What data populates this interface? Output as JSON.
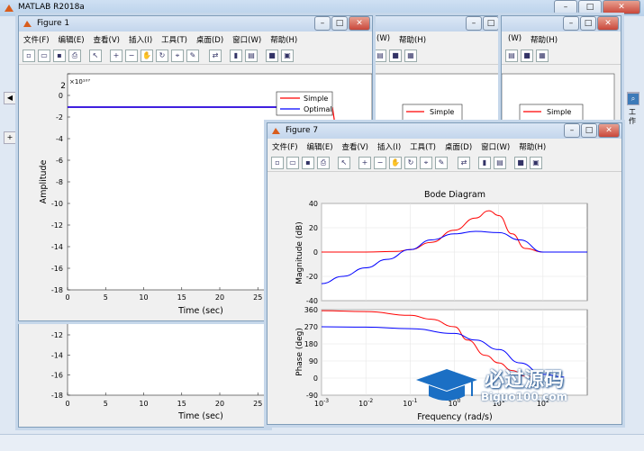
{
  "main_window": {
    "title": "MATLAB R2018a",
    "side_label": "工作"
  },
  "menus": [
    "文件(F)",
    "编辑(E)",
    "查看(V)",
    "插入(I)",
    "工具(T)",
    "桌面(D)",
    "窗口(W)",
    "帮助(H)"
  ],
  "menus_partial": [
    "(W)",
    "帮助(H)"
  ],
  "figure1": {
    "title": "Figure 1",
    "exponent": "×10¹⁰⁷",
    "exp_base": "2",
    "xlabel": "Time (sec)",
    "ylabel": "Amplitude",
    "legend": [
      "Simple",
      "Optimal"
    ]
  },
  "figure_lower": {
    "xlabel": "Time (sec)"
  },
  "figure_back": {
    "legend": [
      "Simple",
      "Optimal"
    ]
  },
  "figure7": {
    "title": "Figure 7",
    "plot_title": "Bode Diagram",
    "mag_ylabel": "Magnitude (dB)",
    "phase_ylabel": "Phase (deg)",
    "xlabel": "Frequency  (rad/s)"
  },
  "watermark": {
    "name": "必过源码",
    "url": "Biguo100.com"
  },
  "chart_data": [
    {
      "type": "line",
      "title": "",
      "xlabel": "Time (sec)",
      "ylabel": "Amplitude",
      "x_ticks": [
        "0",
        "5",
        "10",
        "15",
        "20",
        "25",
        "30",
        "35"
      ],
      "y_ticks": [
        "2",
        "0",
        "-2",
        "-4",
        "-6",
        "-8",
        "-10",
        "-12",
        "-14",
        "-16",
        "-18"
      ],
      "exponent": "10^107",
      "xlim": [
        0,
        40
      ],
      "ylim": [
        -18,
        2
      ],
      "series": [
        {
          "name": "Simple",
          "color": "#ff0000",
          "x": [
            0,
            38
          ],
          "y": [
            0,
            0
          ]
        },
        {
          "name": "Optimal",
          "color": "#0000ff",
          "x": [
            0,
            38
          ],
          "y": [
            0,
            0
          ]
        }
      ],
      "legend_position": "top-right"
    },
    {
      "type": "line",
      "title": "",
      "xlabel": "Time (sec)",
      "x_ticks": [
        "0",
        "5",
        "10",
        "15",
        "20",
        "25",
        "30",
        "35"
      ],
      "y_ticks": [
        "-12",
        "-14",
        "-16",
        "-18"
      ],
      "xlim": [
        0,
        40
      ],
      "ylim": [
        -18,
        -10
      ]
    },
    {
      "type": "line",
      "title": "Bode Diagram",
      "xlabel": "Frequency  (rad/s)",
      "ylabel": "Magnitude (dB)",
      "x_scale": "log",
      "x_ticks": [
        "10^-3",
        "10^-2",
        "10^-1",
        "10^0",
        "10^1",
        "10^2"
      ],
      "y_ticks": [
        "40",
        "20",
        "0",
        "-20",
        "-40"
      ],
      "xlim": [
        0.001,
        1000
      ],
      "ylim": [
        -40,
        40
      ],
      "series": [
        {
          "name": "Simple",
          "color": "#ff0000",
          "x": [
            0.001,
            0.01,
            0.05,
            0.1,
            0.3,
            1,
            3,
            6,
            10,
            20,
            40,
            100,
            300,
            1000
          ],
          "y": [
            0,
            0,
            0.5,
            2,
            8,
            18,
            28,
            34,
            30,
            15,
            3,
            0,
            0,
            0
          ]
        },
        {
          "name": "Optimal",
          "color": "#0000ff",
          "x": [
            0.001,
            0.003,
            0.01,
            0.03,
            0.1,
            0.3,
            1,
            3,
            10,
            30,
            100,
            300,
            1000
          ],
          "y": [
            -26,
            -20,
            -13,
            -6,
            2,
            10,
            15,
            17,
            16,
            10,
            0,
            0,
            0
          ]
        }
      ]
    },
    {
      "type": "line",
      "title": "",
      "xlabel": "Frequency  (rad/s)",
      "ylabel": "Phase (deg)",
      "x_scale": "log",
      "x_ticks": [
        "10^-3",
        "10^-2",
        "10^-1",
        "10^0",
        "10^1",
        "10^2"
      ],
      "y_ticks": [
        "360",
        "270",
        "180",
        "90",
        "0",
        "-90"
      ],
      "xlim": [
        0.001,
        1000
      ],
      "ylim": [
        -90,
        360
      ],
      "series": [
        {
          "name": "Simple",
          "color": "#ff0000",
          "x": [
            0.001,
            0.01,
            0.1,
            0.3,
            1,
            2,
            5,
            10,
            20,
            40,
            100
          ],
          "y": [
            355,
            350,
            330,
            310,
            270,
            200,
            120,
            80,
            40,
            10,
            0
          ]
        },
        {
          "name": "Optimal",
          "color": "#0000ff",
          "x": [
            0.001,
            0.01,
            0.1,
            1,
            3,
            10,
            30,
            100,
            300
          ],
          "y": [
            270,
            268,
            260,
            235,
            200,
            150,
            80,
            20,
            5
          ]
        }
      ]
    }
  ]
}
